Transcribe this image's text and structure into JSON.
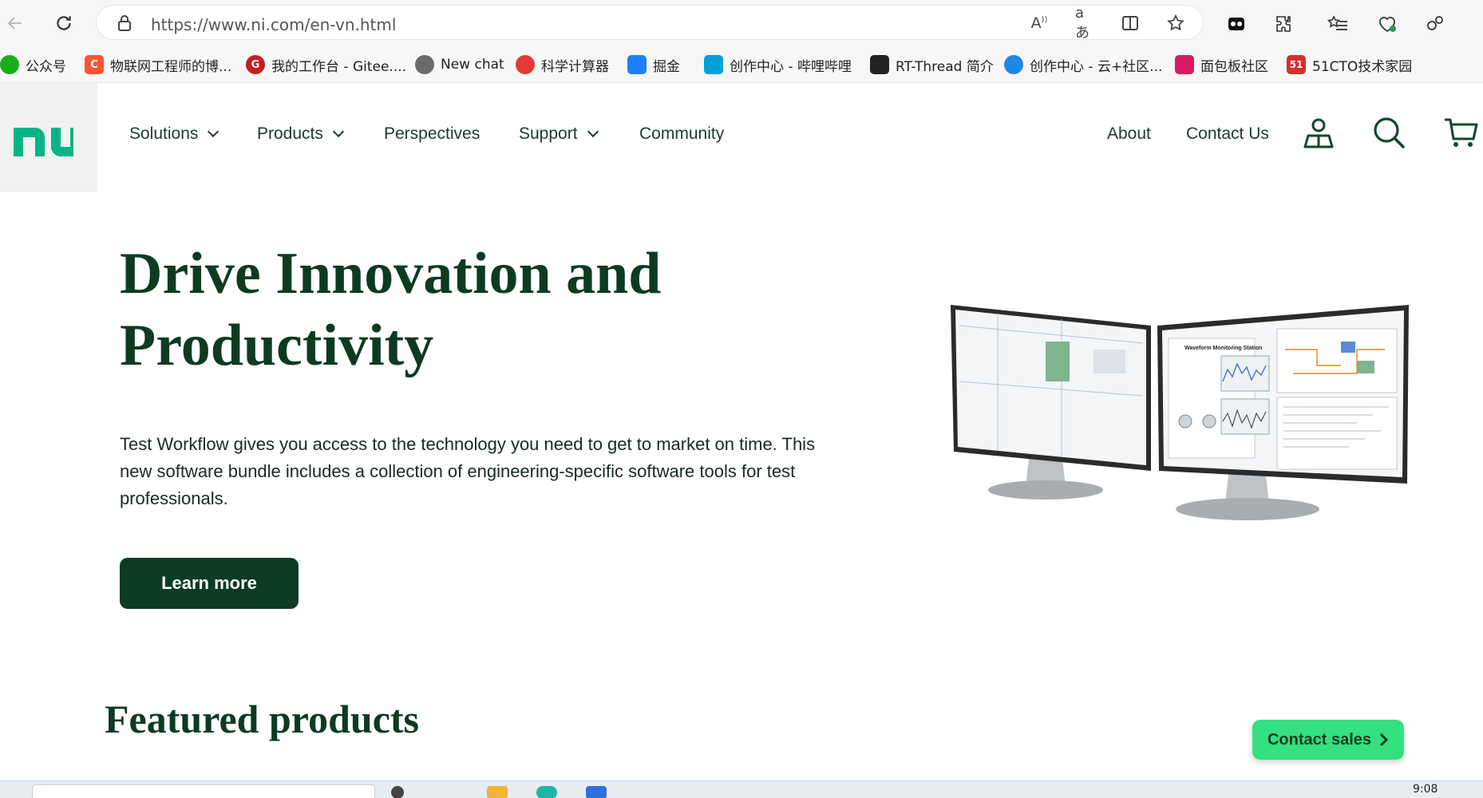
{
  "browser": {
    "url": "https://www.ni.com/en-vn.html",
    "bookmarks": [
      {
        "label": "公众号",
        "icon": "wechat-icon",
        "color": "#1aad19"
      },
      {
        "label": "物联网工程师的博...",
        "icon": "csdn-icon",
        "color": "#fc5531"
      },
      {
        "label": "我的工作台 - Gitee....",
        "icon": "gitee-icon",
        "color": "#c71d23"
      },
      {
        "label": "New chat",
        "icon": "chatgpt-icon",
        "color": "#6b6b6b"
      },
      {
        "label": "科学计算器",
        "icon": "calculator-icon",
        "color": "#e53935"
      },
      {
        "label": "掘金",
        "icon": "juejin-icon",
        "color": "#1e80ff"
      },
      {
        "label": "创作中心 - 哔哩哔哩",
        "icon": "bilibili-icon",
        "color": "#00a1d6"
      },
      {
        "label": "RT-Thread 简介",
        "icon": "book-icon",
        "color": "#222222"
      },
      {
        "label": "创作中心 - 云+社区...",
        "icon": "cloud-icon",
        "color": "#1e88e5"
      },
      {
        "label": "面包板社区",
        "icon": "mianbaoban-icon",
        "color": "#d81b60"
      },
      {
        "label": "51CTO技术家园",
        "icon": "51cto-icon",
        "color": "#d32f2f"
      }
    ],
    "bookmark_fav_text": [
      "",
      "C",
      "G",
      "",
      "",
      "",
      "",
      "",
      "",
      "",
      "51"
    ]
  },
  "header": {
    "nav": [
      {
        "label": "Solutions",
        "has_dropdown": true
      },
      {
        "label": "Products",
        "has_dropdown": true
      },
      {
        "label": "Perspectives",
        "has_dropdown": false
      },
      {
        "label": "Support",
        "has_dropdown": true
      },
      {
        "label": "Community",
        "has_dropdown": false
      }
    ],
    "right_links": [
      "About",
      "Contact Us"
    ]
  },
  "hero": {
    "title": "Drive Innovation and Productivity",
    "description": "Test Workflow gives you access to the technology you need to get to market on time. This new software bundle includes a collection of engineering-specific software tools for test professionals.",
    "cta_label": "Learn more",
    "image_caption": "Waveform Monitoring Station"
  },
  "featured": {
    "title": "Featured products"
  },
  "contact_sales": {
    "label": "Contact sales"
  },
  "taskbar": {
    "clock": "9:08"
  },
  "colors": {
    "brand_green": "#0d3b24",
    "accent_green": "#34e07f",
    "logo_green": "#03b585"
  }
}
